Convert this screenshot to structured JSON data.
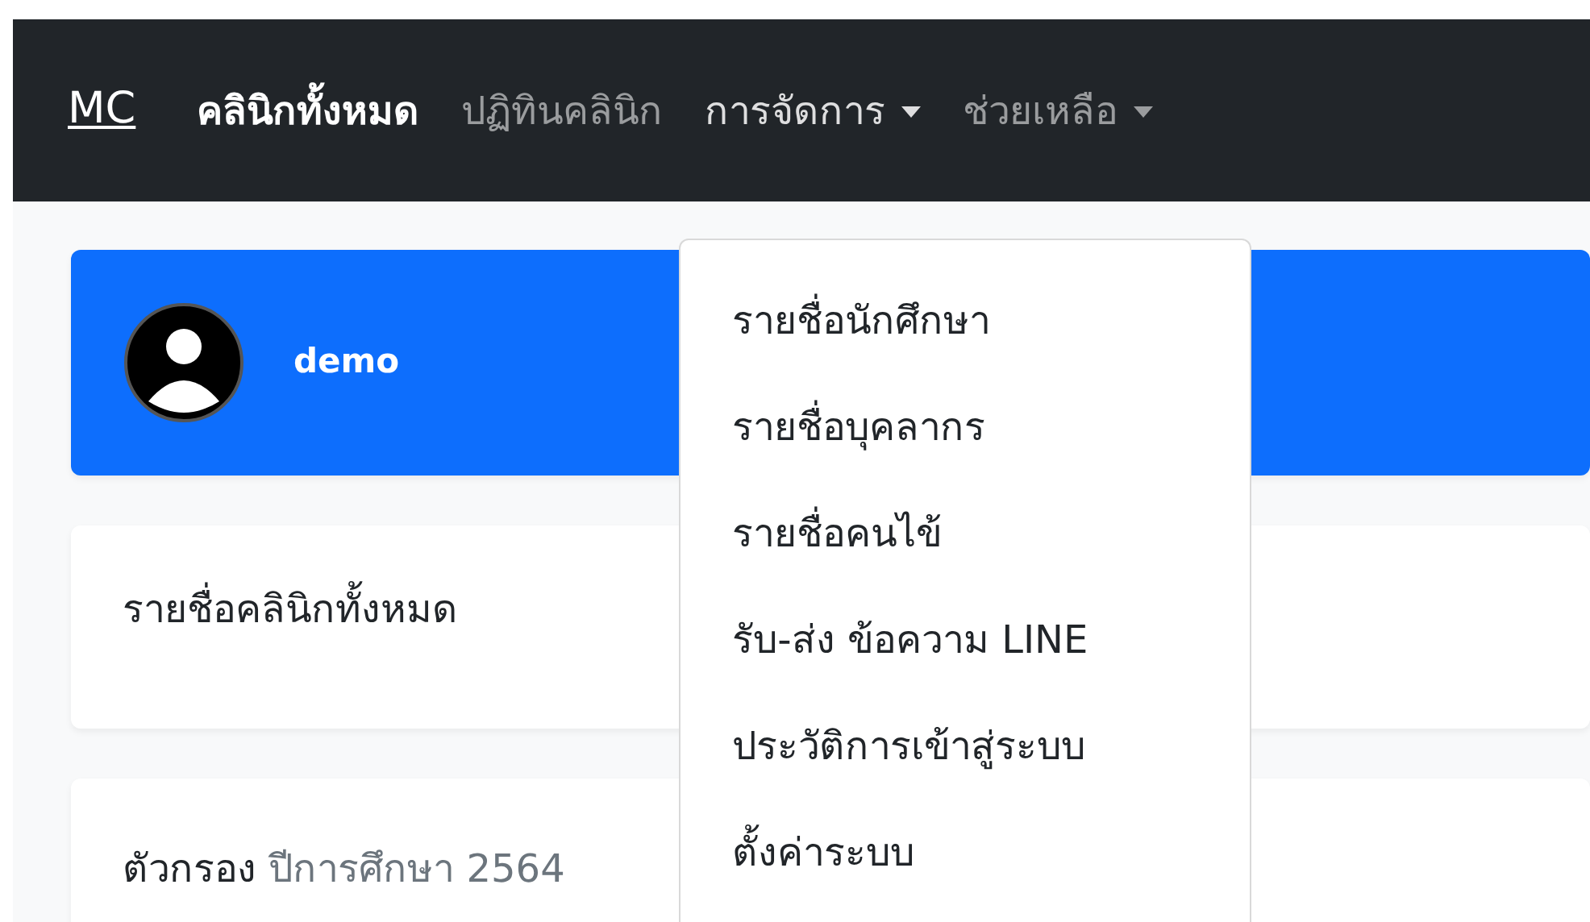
{
  "navbar": {
    "brand": "MC",
    "items": [
      {
        "label": "คลินิกทั้งหมด",
        "kind": "link",
        "selected": true
      },
      {
        "label": "ปฏิทินคลินิก",
        "kind": "link",
        "selected": false
      },
      {
        "label": "การจัดการ",
        "kind": "dropdown",
        "selected": false,
        "expanded": true,
        "menu": [
          "รายชื่อนักศึกษา",
          "รายชื่อบุคลากร",
          "รายชื่อคนไข้",
          "รับ-ส่ง ข้อความ LINE",
          "ประวัติการเข้าสู่ระบบ",
          "ตั้งค่าระบบ"
        ]
      },
      {
        "label": "ช่วยเหลือ",
        "kind": "dropdown",
        "selected": false,
        "expanded": false
      }
    ]
  },
  "user_card": {
    "username": "demo"
  },
  "title_card": {
    "title": "รายชื่อคลินิกทั้งหมด"
  },
  "filter_card": {
    "label": "ตัวกรอง",
    "value": "ปีการศึกษา 2564"
  }
}
